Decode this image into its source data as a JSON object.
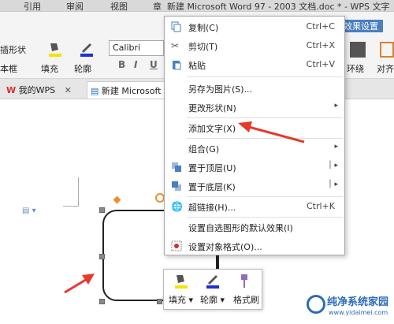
{
  "titlebar": {
    "doc_title": "新建 Microsoft Word 97 - 2003 文档.doc * - WPS 文字",
    "tabs": [
      "引用",
      "审阅",
      "视图",
      "章"
    ],
    "active_tab": "效果设置"
  },
  "ribbon": {
    "shape_label": "插形状",
    "textbox_label": "本框",
    "fill_label": "填充",
    "outline_label": "轮廓",
    "font_name": "Calibri",
    "bold": "B",
    "italic": "I",
    "underline": "U",
    "wrap_label": "环绕",
    "align_label": "对齐"
  },
  "tabstrip": {
    "wps_tab": "我的WPS",
    "doc_tab": "新建 Microsoft Wo"
  },
  "context_menu": {
    "items": [
      {
        "label": "复制(C)",
        "shortcut": "Ctrl+C"
      },
      {
        "label": "剪切(T)",
        "shortcut": "Ctrl+X"
      },
      {
        "label": "粘贴",
        "shortcut": "Ctrl+V"
      },
      {
        "label": "另存为图片(S)..."
      },
      {
        "label": "更改形状(N)"
      },
      {
        "label": "添加文字(X)"
      },
      {
        "label": "组合(G)"
      },
      {
        "label": "置于顶层(U)"
      },
      {
        "label": "置于底层(K)"
      },
      {
        "label": "超链接(H)...",
        "shortcut": "Ctrl+K"
      },
      {
        "label": "设置自选图形的默认效果(I)"
      },
      {
        "label": "设置对象格式(O)..."
      }
    ]
  },
  "mini_toolbar": {
    "fill": "填充",
    "outline": "轮廓",
    "format_painter": "格式刷"
  },
  "watermark": {
    "title": "纯净系统家园",
    "url": "www.yidaimei.com"
  },
  "colors": {
    "accent": "#4a7fc1",
    "arrow": "#e8392a",
    "fill_yellow": "#f5e400",
    "outline_blue": "#1e2fd6"
  }
}
